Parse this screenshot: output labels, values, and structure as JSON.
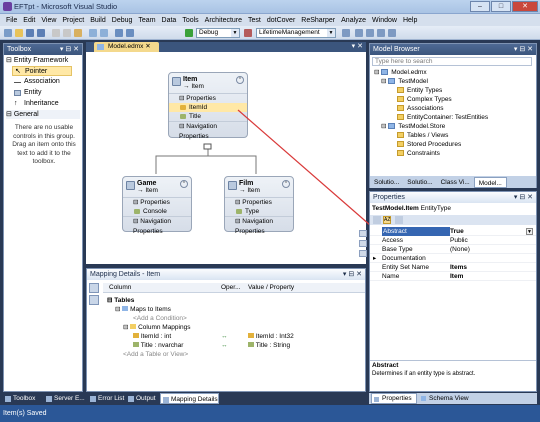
{
  "window": {
    "title": "EFTpt - Microsoft Visual Studio",
    "buttons": [
      "–",
      "□",
      "✕"
    ]
  },
  "menu": [
    "File",
    "Edit",
    "View",
    "Project",
    "Build",
    "Debug",
    "Team",
    "Data",
    "Tools",
    "Architecture",
    "Test",
    "dotCover",
    "ReSharper",
    "Analyze",
    "Window",
    "Help"
  ],
  "toolbar": {
    "config": "Debug",
    "target": "LifetimeManagement"
  },
  "toolbox": {
    "title": "Toolbox",
    "group1": "Entity Framework",
    "items": [
      "Pointer",
      "Association",
      "Entity",
      "Inheritance"
    ],
    "group2": "General",
    "empty_text": "There are no usable controls in this group. Drag an item onto this text to add it to the toolbox."
  },
  "doc_tab": "Model.edmx",
  "entities": {
    "item": {
      "name": "Item",
      "sub": "Item",
      "props_label": "Properties",
      "props": [
        "ItemId",
        "Title"
      ],
      "nav_label": "Navigation Properties"
    },
    "game": {
      "name": "Game",
      "sub": "Item",
      "props_label": "Properties",
      "props": [
        "Console"
      ],
      "nav_label": "Navigation Properties"
    },
    "film": {
      "name": "Film",
      "sub": "Item",
      "props_label": "Properties",
      "props": [
        "Type"
      ],
      "nav_label": "Navigation Properties"
    }
  },
  "model_browser": {
    "title": "Model Browser",
    "search_placeholder": "Type here to search",
    "tree": [
      {
        "label": "Model.edmx",
        "indent": 0,
        "icon": "model"
      },
      {
        "label": "TestModel",
        "indent": 1,
        "icon": "model"
      },
      {
        "label": "Entity Types",
        "indent": 2,
        "icon": "folder"
      },
      {
        "label": "Complex Types",
        "indent": 2,
        "icon": "folder"
      },
      {
        "label": "Associations",
        "indent": 2,
        "icon": "folder"
      },
      {
        "label": "EntityContainer: TestEntities",
        "indent": 2,
        "icon": "folder"
      },
      {
        "label": "TestModel.Store",
        "indent": 1,
        "icon": "model"
      },
      {
        "label": "Tables / Views",
        "indent": 2,
        "icon": "folder"
      },
      {
        "label": "Stored Procedures",
        "indent": 2,
        "icon": "folder"
      },
      {
        "label": "Constraints",
        "indent": 2,
        "icon": "folder"
      }
    ],
    "tabs": [
      "Solutio...",
      "Solutio...",
      "Class Vi...",
      "Model..."
    ]
  },
  "properties": {
    "title": "Properties",
    "object": "TestModel.Item",
    "object_type": "EntityType",
    "rows": [
      {
        "key": "Abstract",
        "value": "True"
      },
      {
        "key": "Access",
        "value": "Public"
      },
      {
        "key": "Base Type",
        "value": "(None)"
      },
      {
        "key": "Documentation",
        "value": ""
      },
      {
        "key": "Entity Set Name",
        "value": "Items"
      },
      {
        "key": "Name",
        "value": "Item"
      }
    ],
    "desc_title": "Abstract",
    "desc_text": "Determines if an entity type is abstract.",
    "tabs": [
      "Properties",
      "Schema View"
    ]
  },
  "mapping": {
    "title": "Mapping Details - Item",
    "columns": [
      "Column",
      "Oper...",
      "Value / Property"
    ],
    "rows": [
      "Tables",
      "Maps to Items",
      "<Add a Condition>",
      "Column Mappings",
      "ItemId : int",
      "Title : nvarchar",
      "<Add a Table or View>"
    ],
    "ops": [
      "↔",
      "↔"
    ],
    "values": [
      "ItemId : Int32",
      "Title : String"
    ]
  },
  "bottom_tabs": [
    "Toolbox",
    "Server E...",
    "Error List",
    "Output",
    "Mapping Details"
  ],
  "status": "Item(s) Saved"
}
